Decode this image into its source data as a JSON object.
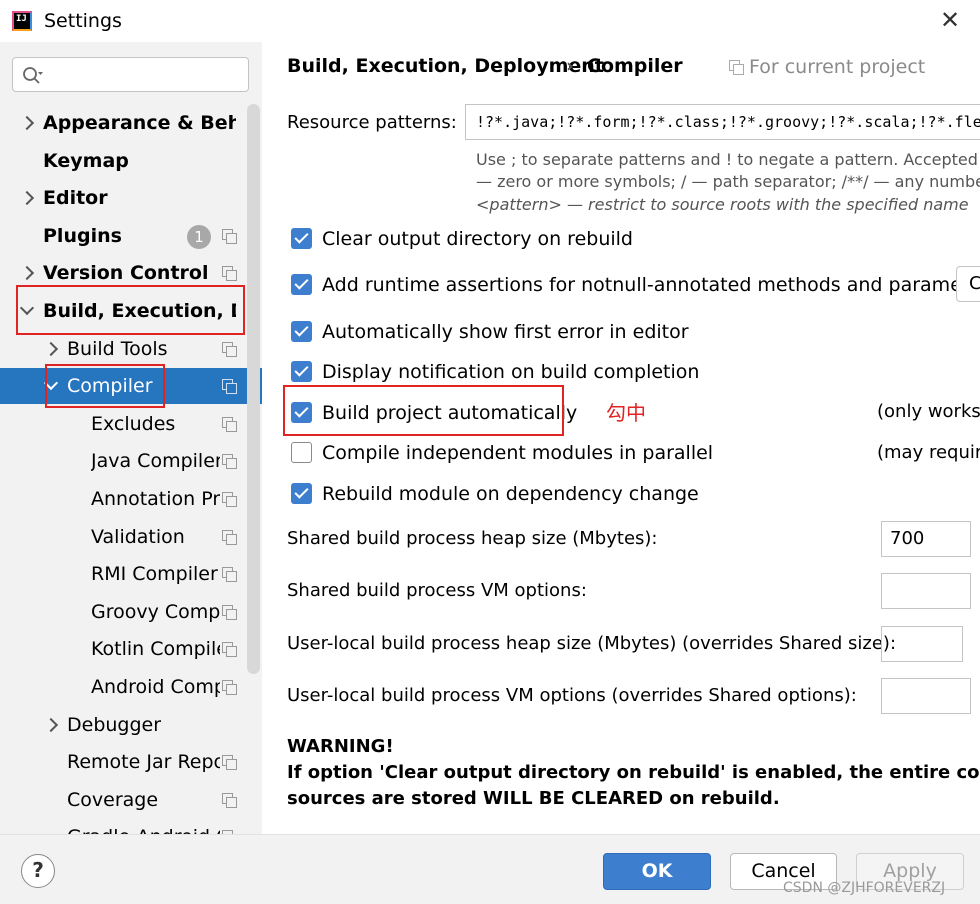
{
  "window": {
    "title": "Settings",
    "close_glyph": "✕",
    "logo_icon": "intellij-logo-icon"
  },
  "sidebar": {
    "search_placeholder": "",
    "items": [
      {
        "label": "Appearance & Behavi",
        "bold": true,
        "arrow": "right",
        "level": 0
      },
      {
        "label": "Keymap",
        "bold": true,
        "arrow": "none",
        "level": 0
      },
      {
        "label": "Editor",
        "bold": true,
        "arrow": "right",
        "level": 0
      },
      {
        "label": "Plugins",
        "bold": true,
        "arrow": "none",
        "level": 0,
        "badge": "1",
        "project_icon": true
      },
      {
        "label": "Version Control",
        "bold": true,
        "arrow": "right",
        "level": 0,
        "project_icon": true
      },
      {
        "label": "Build, Execution, Depl",
        "bold": true,
        "arrow": "down",
        "level": 0
      },
      {
        "label": "Build Tools",
        "arrow": "right",
        "level": 1,
        "project_icon": true
      },
      {
        "label": "Compiler",
        "arrow": "down",
        "level": 1,
        "project_icon": true,
        "selected": true
      },
      {
        "label": "Excludes",
        "level": 2,
        "project_icon": true
      },
      {
        "label": "Java Compiler",
        "level": 2,
        "project_icon": true
      },
      {
        "label": "Annotation Pro",
        "level": 2,
        "project_icon": true
      },
      {
        "label": "Validation",
        "level": 2,
        "project_icon": true
      },
      {
        "label": "RMI Compiler",
        "level": 2,
        "project_icon": true
      },
      {
        "label": "Groovy Compil",
        "level": 2,
        "project_icon": true
      },
      {
        "label": "Kotlin Compile",
        "level": 2,
        "project_icon": true
      },
      {
        "label": "Android Comp",
        "level": 2,
        "project_icon": true
      },
      {
        "label": "Debugger",
        "arrow": "right",
        "level": 1
      },
      {
        "label": "Remote Jar Repo",
        "level": 1,
        "project_icon": true
      },
      {
        "label": "Coverage",
        "level": 1,
        "project_icon": true
      },
      {
        "label": "Gradle-Android C",
        "level": 1,
        "project_icon": true
      }
    ]
  },
  "breadcrumb": {
    "parent": "Build, Execution, Deployment",
    "separator": "›",
    "current": "Compiler",
    "scope": "For current project"
  },
  "resource_patterns": {
    "label": "Resource patterns:",
    "value": "!?*.java;!?*.form;!?*.class;!?*.groovy;!?*.scala;!?*.flex;!?*.kt;!?*.clj;!?*.aj",
    "hint_lines": [
      "Use ; to separate patterns and ! to negate a pattern. Accepted wild",
      "— zero or more symbols; / — path separator; /**/ — any number",
      "<pattern> — restrict to source roots with the specified name"
    ]
  },
  "options": [
    {
      "label": "Clear output directory on rebuild",
      "checked": true
    },
    {
      "label": "Add runtime assertions for notnull-annotated methods and parameters",
      "checked": true,
      "button": "C"
    },
    {
      "label": "Automatically show first error in editor",
      "checked": true
    },
    {
      "label": "Display notification on build completion",
      "checked": true
    },
    {
      "label": "Build project automatically",
      "checked": true,
      "note": "(only works"
    },
    {
      "label": "Compile independent modules in parallel",
      "checked": false,
      "note": "(may require"
    },
    {
      "label": "Rebuild module on dependency change",
      "checked": true
    }
  ],
  "annotation": "勾中",
  "fields": [
    {
      "label": "Shared build process heap size (Mbytes):",
      "value": "700"
    },
    {
      "label": "Shared build process VM options:",
      "value": ""
    },
    {
      "label": "User-local build process heap size (Mbytes) (overrides Shared size):",
      "value": ""
    },
    {
      "label": "User-local build process VM options (overrides Shared options):",
      "value": ""
    }
  ],
  "warning": {
    "title": "WARNING!",
    "line1": "If option 'Clear output directory on rebuild' is enabled, the entire contents of",
    "line2": "sources are stored WILL BE CLEARED on rebuild."
  },
  "footer": {
    "help": "?",
    "ok": "OK",
    "cancel": "Cancel",
    "apply": "Apply",
    "watermark": "CSDN @ZJHFOREVERZJ"
  }
}
